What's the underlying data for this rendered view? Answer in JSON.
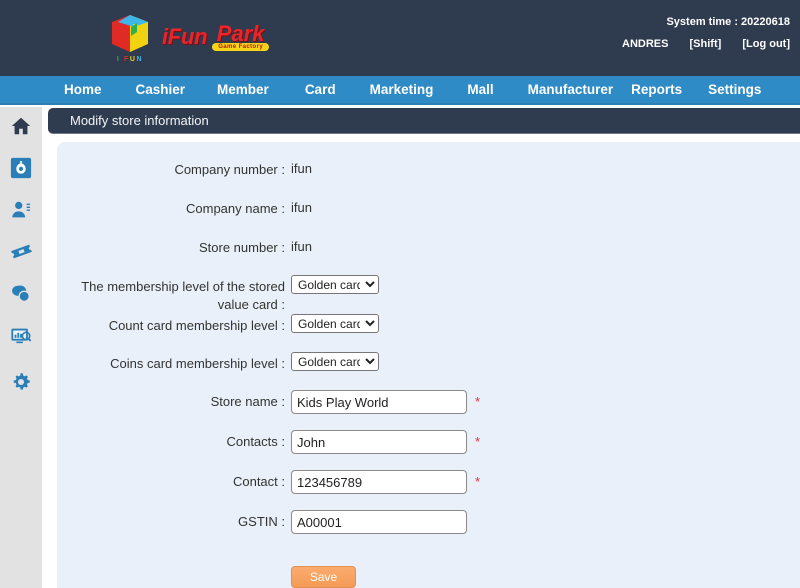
{
  "header": {
    "logo_alt": "iFun Park",
    "logo_ifun": "iFun",
    "logo_park": "Park",
    "logo_sub": "Game Factory",
    "logo_cube_caption": "IFUN",
    "system_time_label": "System time : 20220618",
    "user": "ANDRES",
    "shift_label": "[Shift]",
    "logout_label": "[Log out]"
  },
  "nav": {
    "items": [
      {
        "label": "Home"
      },
      {
        "label": "Cashier"
      },
      {
        "label": "Member"
      },
      {
        "label": "Card"
      },
      {
        "label": "Marketing"
      },
      {
        "label": "Mall"
      },
      {
        "label": "Manufacturer"
      },
      {
        "label": "Reports"
      },
      {
        "label": "Settings"
      }
    ]
  },
  "sidebar": {
    "items": [
      {
        "icon": "home-icon",
        "name": "sidebar-item-home"
      },
      {
        "icon": "cashier-moneybag-icon",
        "name": "sidebar-item-cashier"
      },
      {
        "icon": "member-user-icon",
        "name": "sidebar-item-member"
      },
      {
        "icon": "ticket-card-icon",
        "name": "sidebar-item-card"
      },
      {
        "icon": "chat-marketing-icon",
        "name": "sidebar-item-marketing"
      },
      {
        "icon": "reports-monitor-chart-icon",
        "name": "sidebar-item-reports"
      },
      {
        "icon": "gear-settings-icon",
        "name": "sidebar-item-settings"
      }
    ]
  },
  "page": {
    "title": "Modify store information"
  },
  "form": {
    "company_number_label": "Company number :",
    "company_number_value": "ifun",
    "company_name_label": "Company name :",
    "company_name_value": "ifun",
    "store_number_label": "Store number :",
    "store_number_value": "ifun",
    "stored_value_level_label": "The membership level of the stored value card :",
    "stored_value_level_value": "Golden card",
    "count_card_level_label": "Count card membership level :",
    "count_card_level_value": "Golden card",
    "coins_card_level_label": "Coins card membership level :",
    "coins_card_level_value": "Golden card",
    "membership_options": [
      "Golden card"
    ],
    "store_name_label": "Store name :",
    "store_name_value": "Kids Play World",
    "contacts_label": "Contacts :",
    "contacts_value": "John",
    "contact_label": "Contact :",
    "contact_value": "123456789",
    "gstin_label": "GSTIN :",
    "gstin_value": "A00001",
    "required_marker": "*",
    "save_label": "Save"
  },
  "colors": {
    "header_bg": "#2f3b4f",
    "nav_bg": "#2e8bc6",
    "panel_bg": "#e9f0f9",
    "sidebar_bg": "#e2e2e2",
    "accent_icon": "#2b7fb8",
    "save_btn": "#f59b57",
    "required_red": "#e03131"
  }
}
